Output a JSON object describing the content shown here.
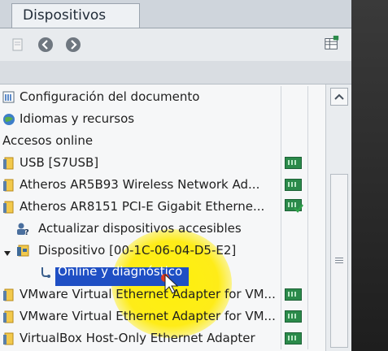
{
  "tab": {
    "title": "Dispositivos"
  },
  "tree": {
    "items": [
      {
        "label": "Configuración del documento"
      },
      {
        "label": "Idiomas y recursos"
      },
      {
        "label": "Accesos online"
      },
      {
        "label": "USB [S7USB]"
      },
      {
        "label": "Atheros AR5B93 Wireless Network Ad..."
      },
      {
        "label": "Atheros AR8151 PCI-E Gigabit Etherne..."
      },
      {
        "label": "Actualizar dispositivos accesibles"
      },
      {
        "label": "Dispositivo [00-1C-06-04-D5-E2]"
      },
      {
        "label": "Online y diagnóstico"
      },
      {
        "label": "VMware Virtual Ethernet Adapter for VM..."
      },
      {
        "label": "VMware Virtual Ethernet Adapter for VM..."
      },
      {
        "label": "VirtualBox Host-Only Ethernet Adapter"
      }
    ]
  },
  "icons": {
    "doc": "document-settings-icon",
    "lang": "globe-icon",
    "folder": "folder-icon",
    "network": "network-adapter-icon",
    "check": "checkmark-icon",
    "update": "refresh-devices-icon",
    "device": "plc-device-icon",
    "diag": "diagnostics-icon"
  },
  "colors": {
    "selection": "#1f4fc4",
    "highlight": "#ffeb00",
    "online_green": "#2b8a4a"
  }
}
